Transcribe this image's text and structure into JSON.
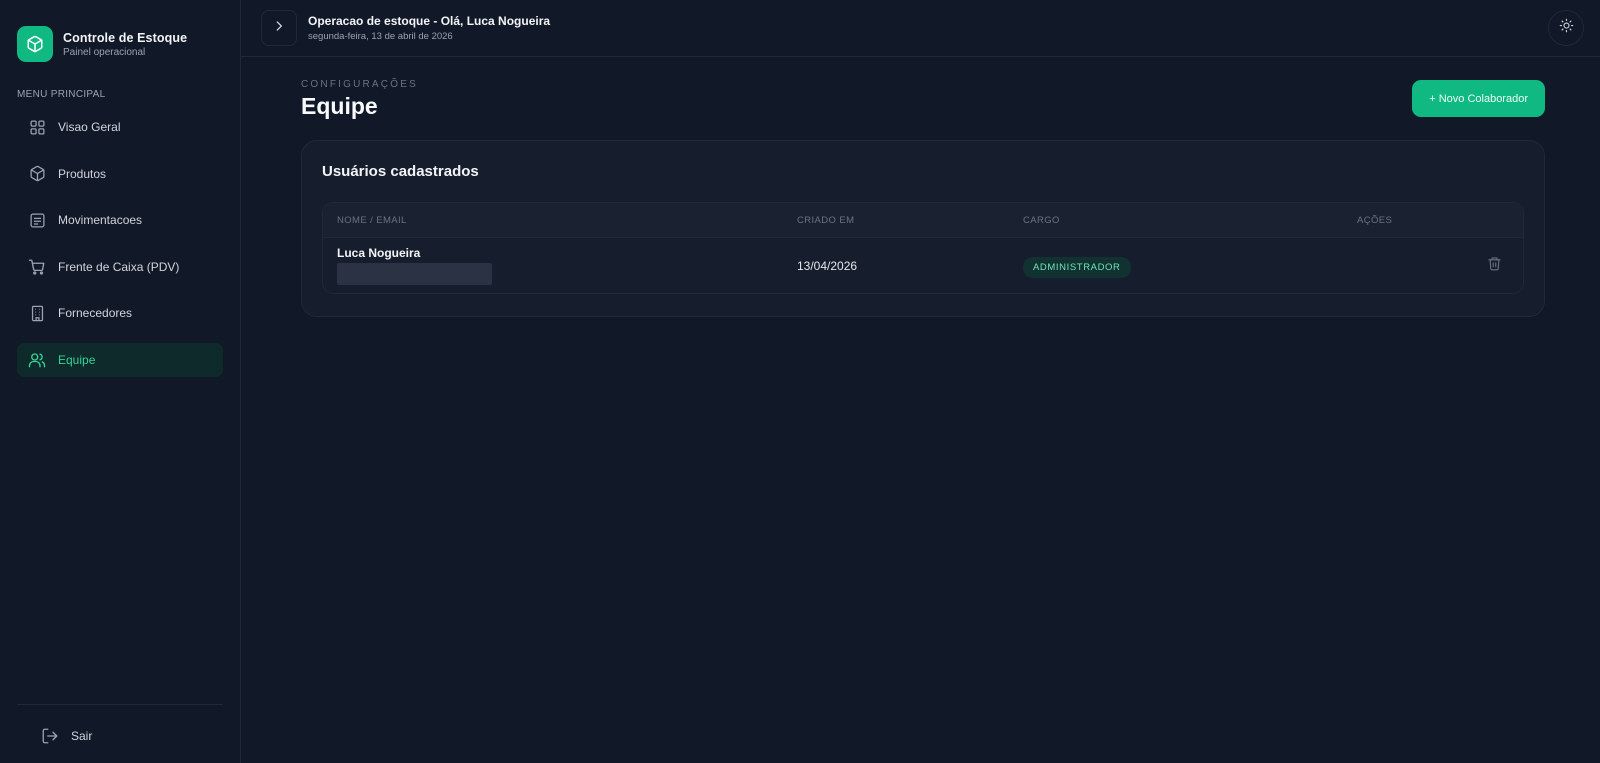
{
  "brand": {
    "title": "Controle de Estoque",
    "subtitle": "Painel operacional",
    "accent": "#10b981"
  },
  "sidebar": {
    "section_label": "MENU PRINCIPAL",
    "items": [
      {
        "label": "Visao Geral",
        "icon": "grid-icon"
      },
      {
        "label": "Produtos",
        "icon": "box-icon"
      },
      {
        "label": "Movimentacoes",
        "icon": "document-icon"
      },
      {
        "label": "Frente de Caixa (PDV)",
        "icon": "cart-icon"
      },
      {
        "label": "Fornecedores",
        "icon": "building-icon"
      },
      {
        "label": "Equipe",
        "icon": "users-icon",
        "active": true
      }
    ],
    "logout_label": "Sair"
  },
  "topbar": {
    "title": "Operacao de estoque - Olá, Luca Nogueira",
    "date": "segunda-feira, 13 de abril de 2026"
  },
  "page": {
    "kicker": "CONFIGURAÇÕES",
    "title": "Equipe",
    "new_button": "+ Novo Colaborador"
  },
  "card": {
    "title": "Usuários cadastrados",
    "columns": {
      "name": "NOME / EMAIL",
      "created": "CRIADO EM",
      "role": "CARGO",
      "actions": "AÇÕES"
    },
    "rows": [
      {
        "name": "Luca Nogueira",
        "created": "13/04/2026",
        "role": "ADMINISTRADOR"
      }
    ]
  }
}
